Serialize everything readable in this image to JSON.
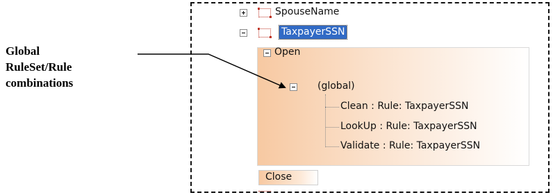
{
  "callout": {
    "lines": [
      "Global",
      "RuleSet/Rule",
      "combinations"
    ]
  },
  "tree": {
    "items": [
      {
        "label": "SpouseName",
        "expander": "plus",
        "icon": "field-icon"
      },
      {
        "label": "TaxpayerSSN",
        "expander": "minus",
        "icon": "field-icon",
        "selected": true
      }
    ],
    "open_node": {
      "label": "Open",
      "expander": "minus"
    },
    "global_node": {
      "label": "(global)",
      "expander": "minus"
    },
    "rules": [
      "Clean : Rule: TaxpayerSSN",
      "LookUp : Rule: TaxpayerSSN",
      "Validate : Rule: TaxpayerSSN"
    ],
    "close_node": {
      "label": "Close"
    }
  },
  "colors": {
    "selection": "#316ac5",
    "panel_gradient_start": "#f7c9a2",
    "field_icon": "#c0392b"
  }
}
